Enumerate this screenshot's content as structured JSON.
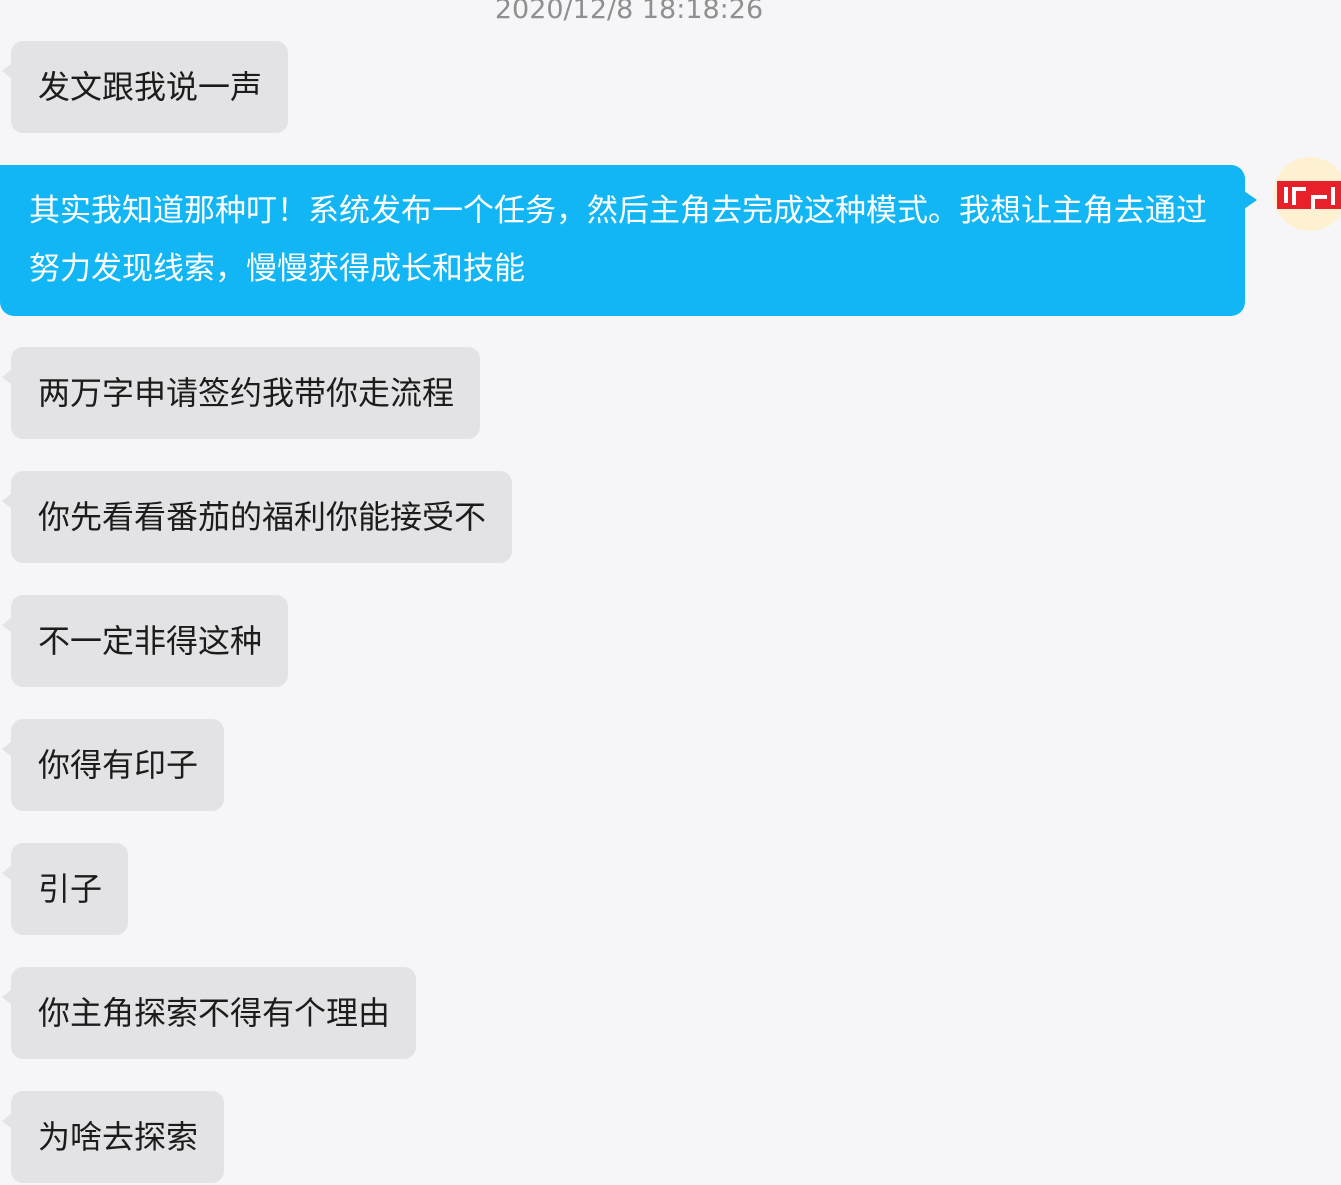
{
  "timestamp": "2020/12/8 18:18:26",
  "messages": [
    {
      "side": "in",
      "text": "发文跟我说一声"
    },
    {
      "side": "out",
      "text": "其实我知道那种叮！系统发布一个任务，然后主角去完成这种模式。我想让主角去通过努力发现线索，慢慢获得成长和技能"
    },
    {
      "side": "in",
      "text": "两万字申请签约我带你走流程"
    },
    {
      "side": "in",
      "text": "你先看看番茄的福利你能接受不"
    },
    {
      "side": "in",
      "text": "不一定非得这种"
    },
    {
      "side": "in",
      "text": "你得有印子"
    },
    {
      "side": "in",
      "text": "引子"
    },
    {
      "side": "in",
      "text": "你主角探索不得有个理由"
    },
    {
      "side": "in",
      "text": "为啥去探索"
    }
  ],
  "colors": {
    "background": "#f6f6f8",
    "incoming_bubble": "#e3e3e5",
    "outgoing_bubble": "#12b6f4",
    "avatar_accent": "#e8202a"
  },
  "icons": {
    "avatar": "user-avatar-red-logo"
  }
}
